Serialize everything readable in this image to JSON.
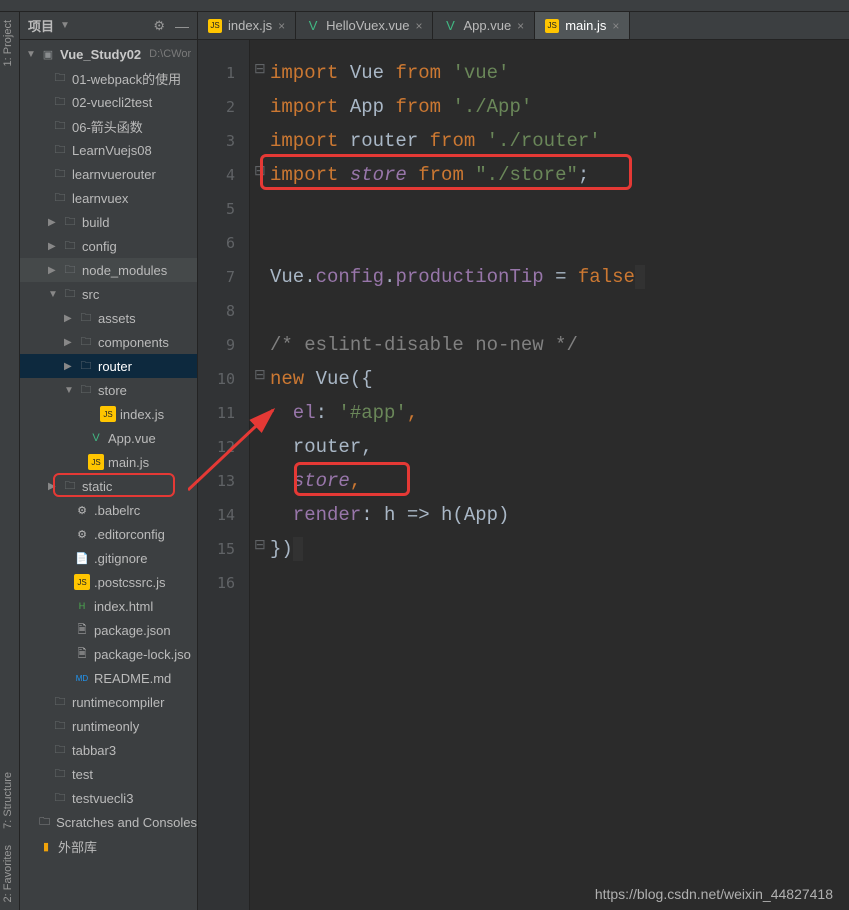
{
  "sidestrip": {
    "project": "1: Project",
    "structure": "7: Structure",
    "favorites": "2: Favorites"
  },
  "panel": {
    "title": "项目",
    "gear": "⚙",
    "minimize": "—"
  },
  "project": {
    "name": "Vue_Study02",
    "path": "D:\\CWor"
  },
  "tree": {
    "items": [
      "01-webpack的使用",
      "02-vuecli2test",
      "06-箭头函数",
      "LearnVuejs08",
      "learnvuerouter",
      "learnvuex"
    ],
    "build": "build",
    "config": "config",
    "node_modules": "node_modules",
    "src": "src",
    "assets": "assets",
    "components": "components",
    "router": "router",
    "store": "store",
    "store_index": "index.js",
    "app_vue": "App.vue",
    "main_js": "main.js",
    "static": "static",
    "babelrc": ".babelrc",
    "editorconfig": ".editorconfig",
    "gitignore": ".gitignore",
    "postcssrc": ".postcssrc.js",
    "index_html": "index.html",
    "package_json": "package.json",
    "package_lock": "package-lock.jso",
    "readme": "README.md",
    "runtimecompiler": "runtimecompiler",
    "runtimeonly": "runtimeonly",
    "tabbar3": "tabbar3",
    "test": "test",
    "testvuecli3": "testvuecli3",
    "scratches": "Scratches and Consoles",
    "external": "外部库"
  },
  "tabs": {
    "t0": "index.js",
    "t1": "HelloVuex.vue",
    "t2": "App.vue",
    "t3": "main.js"
  },
  "lines": {
    "l1": "1",
    "l2": "2",
    "l3": "3",
    "l4": "4",
    "l5": "5",
    "l6": "6",
    "l7": "7",
    "l8": "8",
    "l9": "9",
    "l10": "10",
    "l11": "11",
    "l12": "12",
    "l13": "13",
    "l14": "14",
    "l15": "15",
    "l16": "16"
  },
  "code": {
    "l1": {
      "a": "import",
      "b": " Vue ",
      "c": "from",
      "d": " ",
      "e": "'vue'"
    },
    "l2": {
      "a": "import",
      "b": " App ",
      "c": "from",
      "d": " ",
      "e": "'./App'"
    },
    "l3": {
      "a": "import",
      "b": " router ",
      "c": "from",
      "d": " ",
      "e": "'./router'"
    },
    "l4": {
      "a": "import",
      "b": " ",
      "c": "store",
      "d": " ",
      "e": "from",
      "f": " ",
      "g": "\"./store\"",
      "h": ";"
    },
    "l7a": "Vue.",
    "l7b": "config",
    "l7c": ".",
    "l7d": "productionTip",
    "l7e": " = ",
    "l7f": "false",
    "l9": "/* eslint-disable no-new */",
    "l10a": "new",
    "l10b": " Vue({",
    "l11a": "  el",
    "l11b": ": ",
    "l11c": "'#app'",
    "l11d": ",",
    "l12a": "  router,",
    "l13a": "  ",
    "l13b": "store",
    "l13c": ",",
    "l14a": "  render",
    "l14b": ": h => h(App)",
    "l15": "})"
  },
  "watermark": "https://blog.csdn.net/weixin_44827418"
}
